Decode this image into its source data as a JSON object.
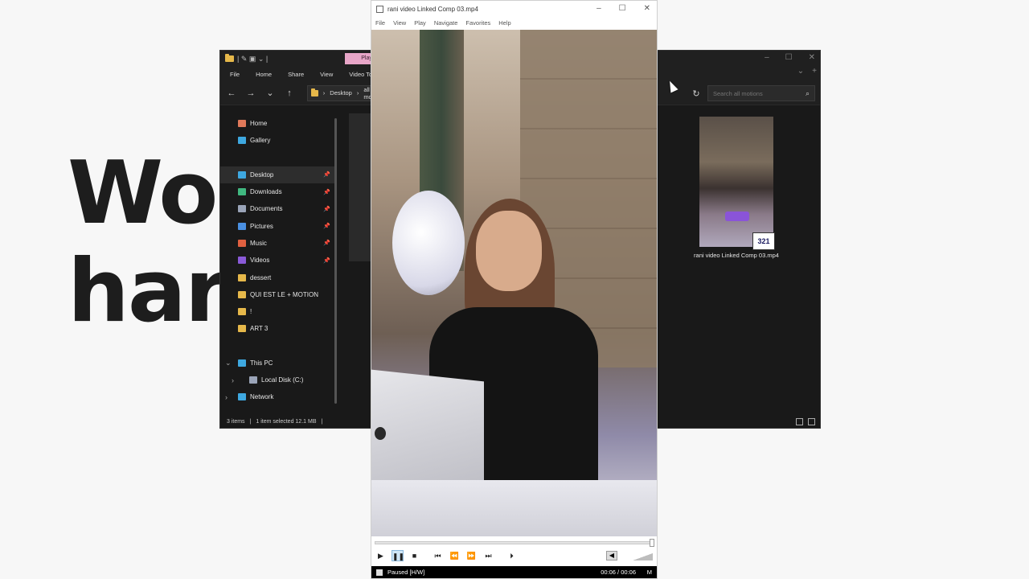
{
  "background": {
    "line1": "Wor",
    "line2": "hard"
  },
  "explorer": {
    "tab_chip": "Play",
    "ribbon": [
      "File",
      "Home",
      "Share",
      "View",
      "Video Tools"
    ],
    "breadcrumb": [
      "Desktop",
      "all motions"
    ],
    "search_placeholder": "Search all motions",
    "nav": [
      {
        "label": "Home",
        "color": "#e0795a"
      },
      {
        "label": "Gallery",
        "color": "#3ea8e0"
      },
      {
        "label": "Desktop",
        "color": "#3ea8e0",
        "pinned": true,
        "active": true
      },
      {
        "label": "Downloads",
        "color": "#40b880",
        "pinned": true
      },
      {
        "label": "Documents",
        "color": "#9aa4b8",
        "pinned": true
      },
      {
        "label": "Pictures",
        "color": "#4a90e2",
        "pinned": true
      },
      {
        "label": "Music",
        "color": "#e06040",
        "pinned": true
      },
      {
        "label": "Videos",
        "color": "#8a5ad8",
        "pinned": true
      },
      {
        "label": "dessert",
        "color": "#e6b84a"
      },
      {
        "label": "QUI EST LE + MOTION",
        "color": "#e6b84a"
      },
      {
        "label": "!",
        "color": "#e6b84a"
      },
      {
        "label": "ART 3",
        "color": "#e6b84a"
      },
      {
        "label": "This PC",
        "color": "#3ea8e0"
      },
      {
        "label": "Local Disk (C:)",
        "color": "#9aa4b8"
      },
      {
        "label": "Network",
        "color": "#3ea8e0"
      }
    ],
    "status_items": "3 items",
    "status_selected": "1 item selected  12.1 MB",
    "file": {
      "name": "rani video Linked Comp 03.mp4",
      "badge": "321"
    }
  },
  "player": {
    "title": "rani video Linked Comp 03.mp4",
    "menu": [
      "File",
      "View",
      "Play",
      "Navigate",
      "Favorites",
      "Help"
    ],
    "status": "Paused [H/W]",
    "time": "00:06 / 00:06",
    "hw": "M"
  }
}
